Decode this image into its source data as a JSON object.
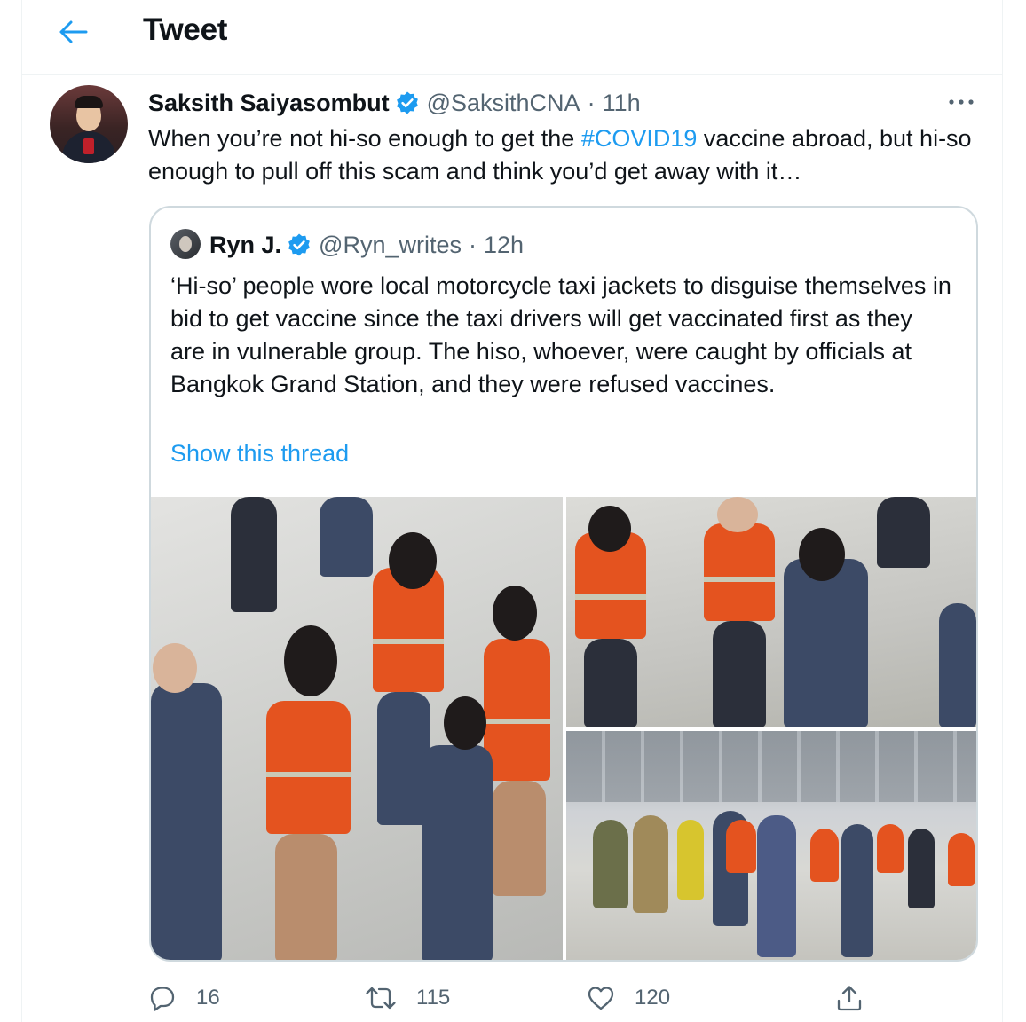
{
  "header": {
    "title": "Tweet"
  },
  "tweet": {
    "author_name": "Saksith Saiyasombut",
    "handle": "@SaksithCNA",
    "separator": "·",
    "time": "11h",
    "text_before": "When you’re not hi-so enough to get the ",
    "hashtag": "#COVID19",
    "text_after": " vaccine abroad, but hi-so enough to pull off this scam and think you’d get away with it…"
  },
  "quote": {
    "author_name": "Ryn J.",
    "handle": "@Ryn_writes",
    "separator": "·",
    "time": "12h",
    "text": "‘Hi-so’ people wore local motorcycle taxi jackets to disguise themselves in bid to get vaccine since the taxi drivers will get vaccinated first as they are in vulnerable group. The hiso, whoever, were caught by officials at Bangkok Grand Station, and they were refused vaccines.",
    "show_thread": "Show this thread"
  },
  "actions": {
    "replies": "16",
    "retweets": "115",
    "likes": "120"
  },
  "icons": [
    "back-arrow-icon",
    "verified-badge-icon",
    "more-options-icon",
    "reply-icon",
    "retweet-icon",
    "like-icon",
    "share-icon"
  ],
  "colors": {
    "accent": "#1d9bf0",
    "text": "#0f1419",
    "muted": "#536471",
    "border": "#cfd9de"
  }
}
